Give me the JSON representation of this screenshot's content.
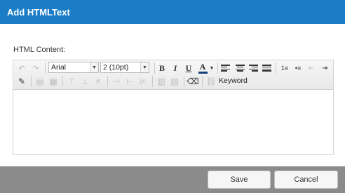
{
  "dialog": {
    "title": "Add HTMLText"
  },
  "form": {
    "label": "HTML Content:"
  },
  "toolbar": {
    "font_family": "Arial",
    "font_size": "2 (10pt)",
    "bold": "B",
    "italic": "I",
    "underline": "U",
    "font_color_letter": "A",
    "keyword_label": "Keyword"
  },
  "editor": {
    "content": ""
  },
  "footer": {
    "save_label": "Save",
    "cancel_label": "Cancel"
  },
  "colors": {
    "titlebar": "#1a7dc6",
    "footer": "#8b8b8b",
    "font_color_bar": "#1a3e7a"
  }
}
